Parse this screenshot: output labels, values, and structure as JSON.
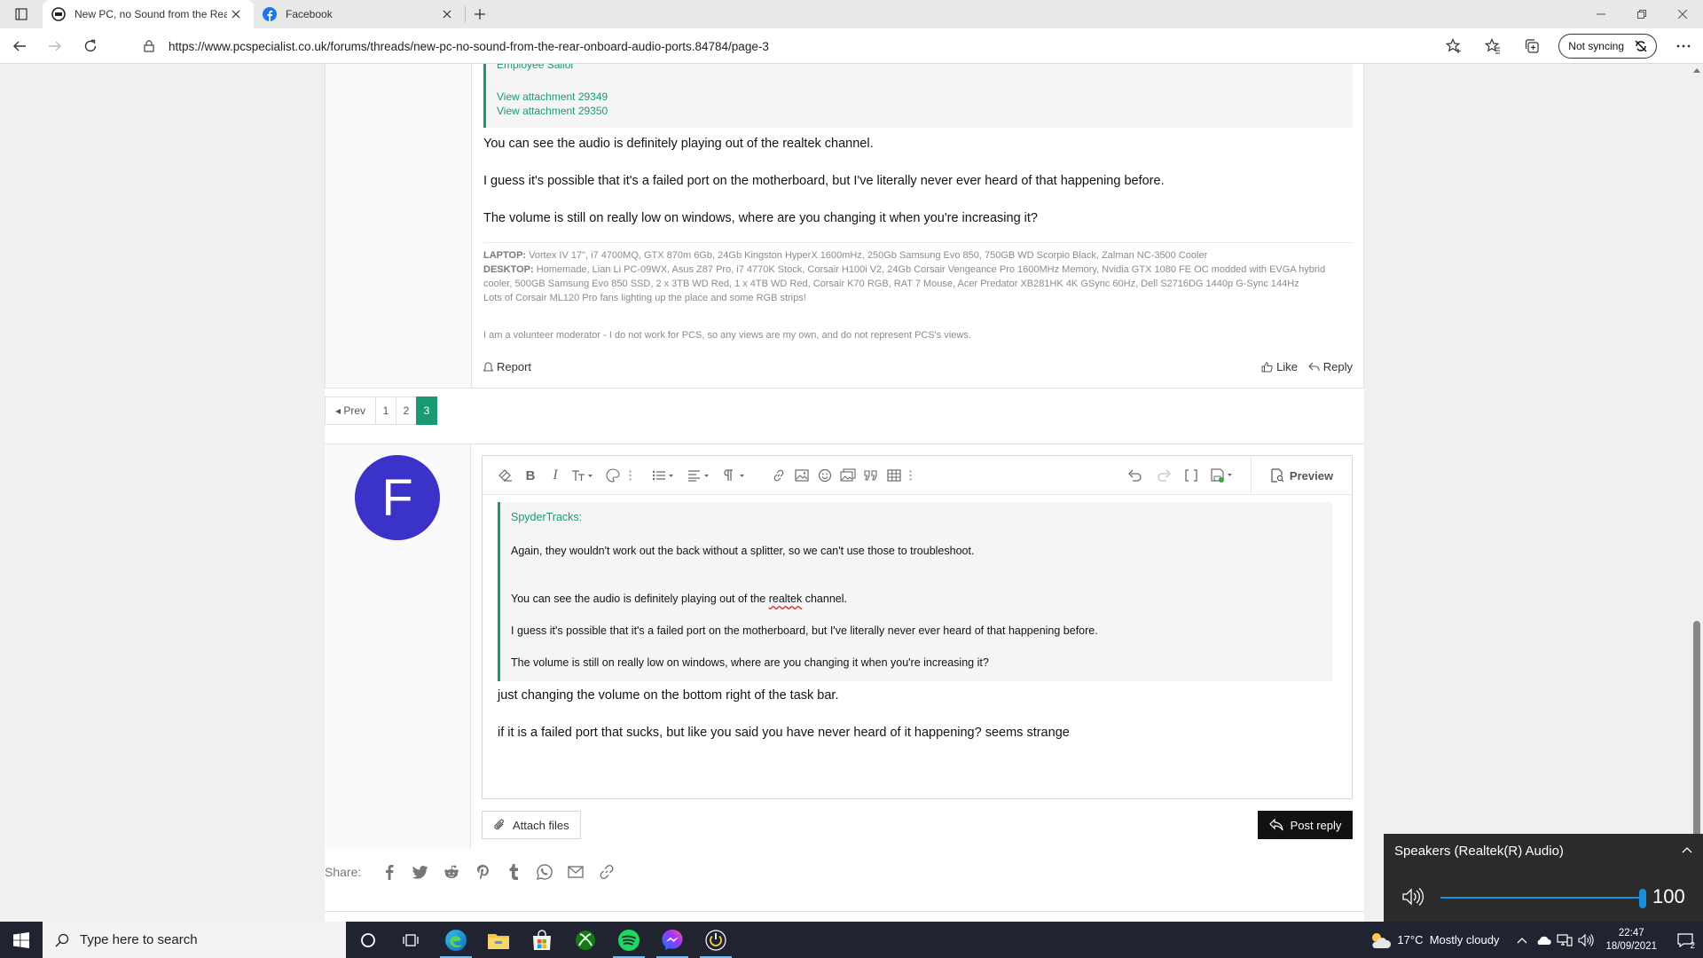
{
  "browser": {
    "tabs": [
      {
        "title": "New PC, no Sound from the Rear",
        "active": true
      },
      {
        "title": "Facebook",
        "active": false
      }
    ],
    "url": "https://www.pcspecialist.co.uk/forums/threads/new-pc-no-sound-from-the-rear-onboard-audio-ports.84784/page-3",
    "sync_label": "Not syncing"
  },
  "previous_post": {
    "quote_clipped": "Employee Sailor",
    "attachments": [
      "View attachment 29349",
      "View attachment 29350"
    ],
    "paragraphs": [
      "You can see the audio is definitely playing out of the realtek channel.",
      "I guess it's possible that it's a failed port on the motherboard, but I've literally never ever heard of that happening before.",
      "The volume is still on really low on windows, where are you changing it when you're increasing it?"
    ],
    "signature": {
      "laptop_label": "LAPTOP:",
      "laptop": "Vortex IV 17\", i7 4700MQ, GTX 870m 6Gb, 24Gb Kingston HyperX 1600mHz, 250Gb Samsung Evo 850, 750GB WD Scorpio Black, Zalman NC-3500 Cooler",
      "desktop_label": "DESKTOP:",
      "desktop": "Homemade, Lian Li PC-09WX, Asus Z87 Pro, i7 4770K Stock, Corsair H100i V2, 24Gb Corsair Vengeance Pro 1600MHz Memory, Nvidia GTX 1080 FE OC modded with EVGA hybrid cooler, 500GB Samsung Evo 850 SSD, 2 x 3TB WD Red, 1 x 4TB WD Red, Corsair K70 RGB, RAT 7 Mouse, Acer Predator XB281HK 4K GSync 60Hz, Dell S2716DG 1440p G-Sync 144Hz",
      "extra": "Lots of Corsair ML120 Pro fans lighting up the place and some RGB strips!",
      "moderator_note": "I am a volunteer moderator - I do not work for PCS, so any views are my own, and do not represent PCS's views."
    },
    "report_label": "Report",
    "like_label": "Like",
    "reply_label": "Reply"
  },
  "pagination": {
    "prev_label": "◂ Prev",
    "pages": [
      "1",
      "2",
      "3"
    ],
    "current": "3"
  },
  "reply_editor": {
    "avatar_letter": "F",
    "preview_label": "Preview",
    "quote": {
      "author": "SpyderTracks:",
      "line1": "Again, they wouldn't work out the back without a splitter, so we can't use those to troubleshoot.",
      "line2_pre": "You can see the audio is definitely playing out of the ",
      "line2_spell": "realtek",
      "line2_post": " channel.",
      "line3": "I guess it's possible that it's a failed port on the motherboard, but I've literally never ever heard of that happening before.",
      "line4": "The volume is still on really low on windows, where are you changing it when you're increasing it?"
    },
    "text": [
      "just changing the volume on the bottom right of the task bar.",
      "if it is a failed port that sucks, but like you said you have never heard of it happening? seems strange"
    ],
    "attach_label": "Attach files",
    "post_label": "Post reply"
  },
  "share": {
    "label": "Share:",
    "icons": [
      "facebook-icon",
      "twitter-icon",
      "reddit-icon",
      "pinterest-icon",
      "tumblr-icon",
      "whatsapp-icon",
      "email-icon",
      "link-icon"
    ]
  },
  "volume": {
    "device": "Speakers (Realtek(R) Audio)",
    "level": "100",
    "level_fraction": 1.0
  },
  "taskbar": {
    "search_placeholder": "Type here to search",
    "weather_temp": "17°C",
    "weather_text": "Mostly cloudy",
    "time": "22:47",
    "date": "18/09/2021",
    "notifications": "2"
  },
  "colors": {
    "accent": "#1a9a73",
    "avatar": "#3a32c9",
    "volume": "#1c8fdc"
  }
}
